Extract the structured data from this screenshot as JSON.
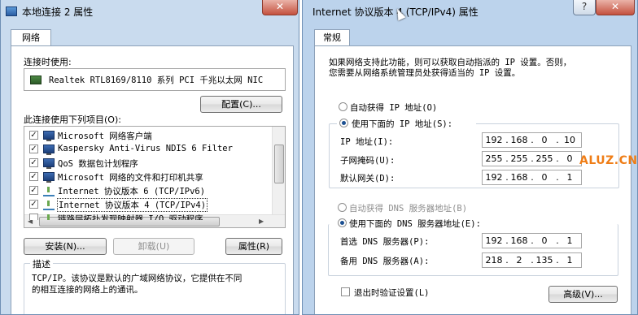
{
  "left_window": {
    "title": "本地连接 2 属性",
    "close_glyph": "✕",
    "tab": "网络",
    "connect_using_label": "连接时使用:",
    "adapter_name": "Realtek RTL8169/8110 系列 PCI 千兆以太网 NIC",
    "configure_button": "配置(C)...",
    "items_label": "此连接使用下列项目(O):",
    "items": [
      {
        "label": "Microsoft 网络客户端",
        "checked": true,
        "icon": "network-client-icon"
      },
      {
        "label": "Kaspersky Anti-Virus NDIS 6 Filter",
        "checked": true,
        "icon": "filter-icon"
      },
      {
        "label": "QoS 数据包计划程序",
        "checked": true,
        "icon": "qos-icon"
      },
      {
        "label": "Microsoft 网络的文件和打印机共享",
        "checked": true,
        "icon": "file-share-icon"
      },
      {
        "label": "Internet 协议版本 6 (TCP/IPv6)",
        "checked": true,
        "icon": "protocol-icon"
      },
      {
        "label": "Internet 协议版本 4 (TCP/IPv4)",
        "checked": true,
        "icon": "protocol-icon"
      },
      {
        "label": "链路层拓扑发现映射器 I/O 驱动程序",
        "checked": false,
        "icon": "protocol-icon"
      }
    ],
    "install_button": "安装(N)...",
    "uninstall_button": "卸载(U)",
    "properties_button": "属性(R)",
    "description_label": "描述",
    "description_text_line1": "TCP/IP。该协议是默认的广域网络协议，它提供在不同",
    "description_text_line2": "的相互连接的网络上的通讯。"
  },
  "right_window": {
    "title": "Internet 协议版本 4 (TCP/IPv4) 属性",
    "help_glyph": "?",
    "close_glyph": "✕",
    "tab": "常规",
    "intro_line1": "如果网络支持此功能，则可以获取自动指派的 IP 设置。否则，",
    "intro_line2": "您需要从网络系统管理员处获得适当的 IP 设置。",
    "auto_ip_label": "自动获得 IP 地址(O)",
    "manual_ip_label": "使用下面的 IP 地址(S):",
    "ip_address_label": "IP 地址(I):",
    "ip_address": [
      "192",
      "168",
      "0",
      "10"
    ],
    "subnet_label": "子网掩码(U):",
    "subnet_mask": [
      "255",
      "255",
      "255",
      "0"
    ],
    "gateway_label": "默认网关(D):",
    "gateway": [
      "192",
      "168",
      "0",
      "1"
    ],
    "auto_dns_label": "自动获得 DNS 服务器地址(B)",
    "manual_dns_label": "使用下面的 DNS 服务器地址(E):",
    "preferred_dns_label": "首选 DNS 服务器(P):",
    "preferred_dns": [
      "192",
      "168",
      "0",
      "1"
    ],
    "alternate_dns_label": "备用 DNS 服务器(A):",
    "alternate_dns": [
      "218",
      "2",
      "135",
      "1"
    ],
    "validate_label": "退出时验证设置(L)",
    "advanced_button": "高级(V)...",
    "ip_mode": "manual",
    "dns_mode": "manual"
  },
  "watermark": "ALUZ.CN",
  "colors": {
    "window_frame": "#c9dbee",
    "watermark": "#ef7d16"
  }
}
